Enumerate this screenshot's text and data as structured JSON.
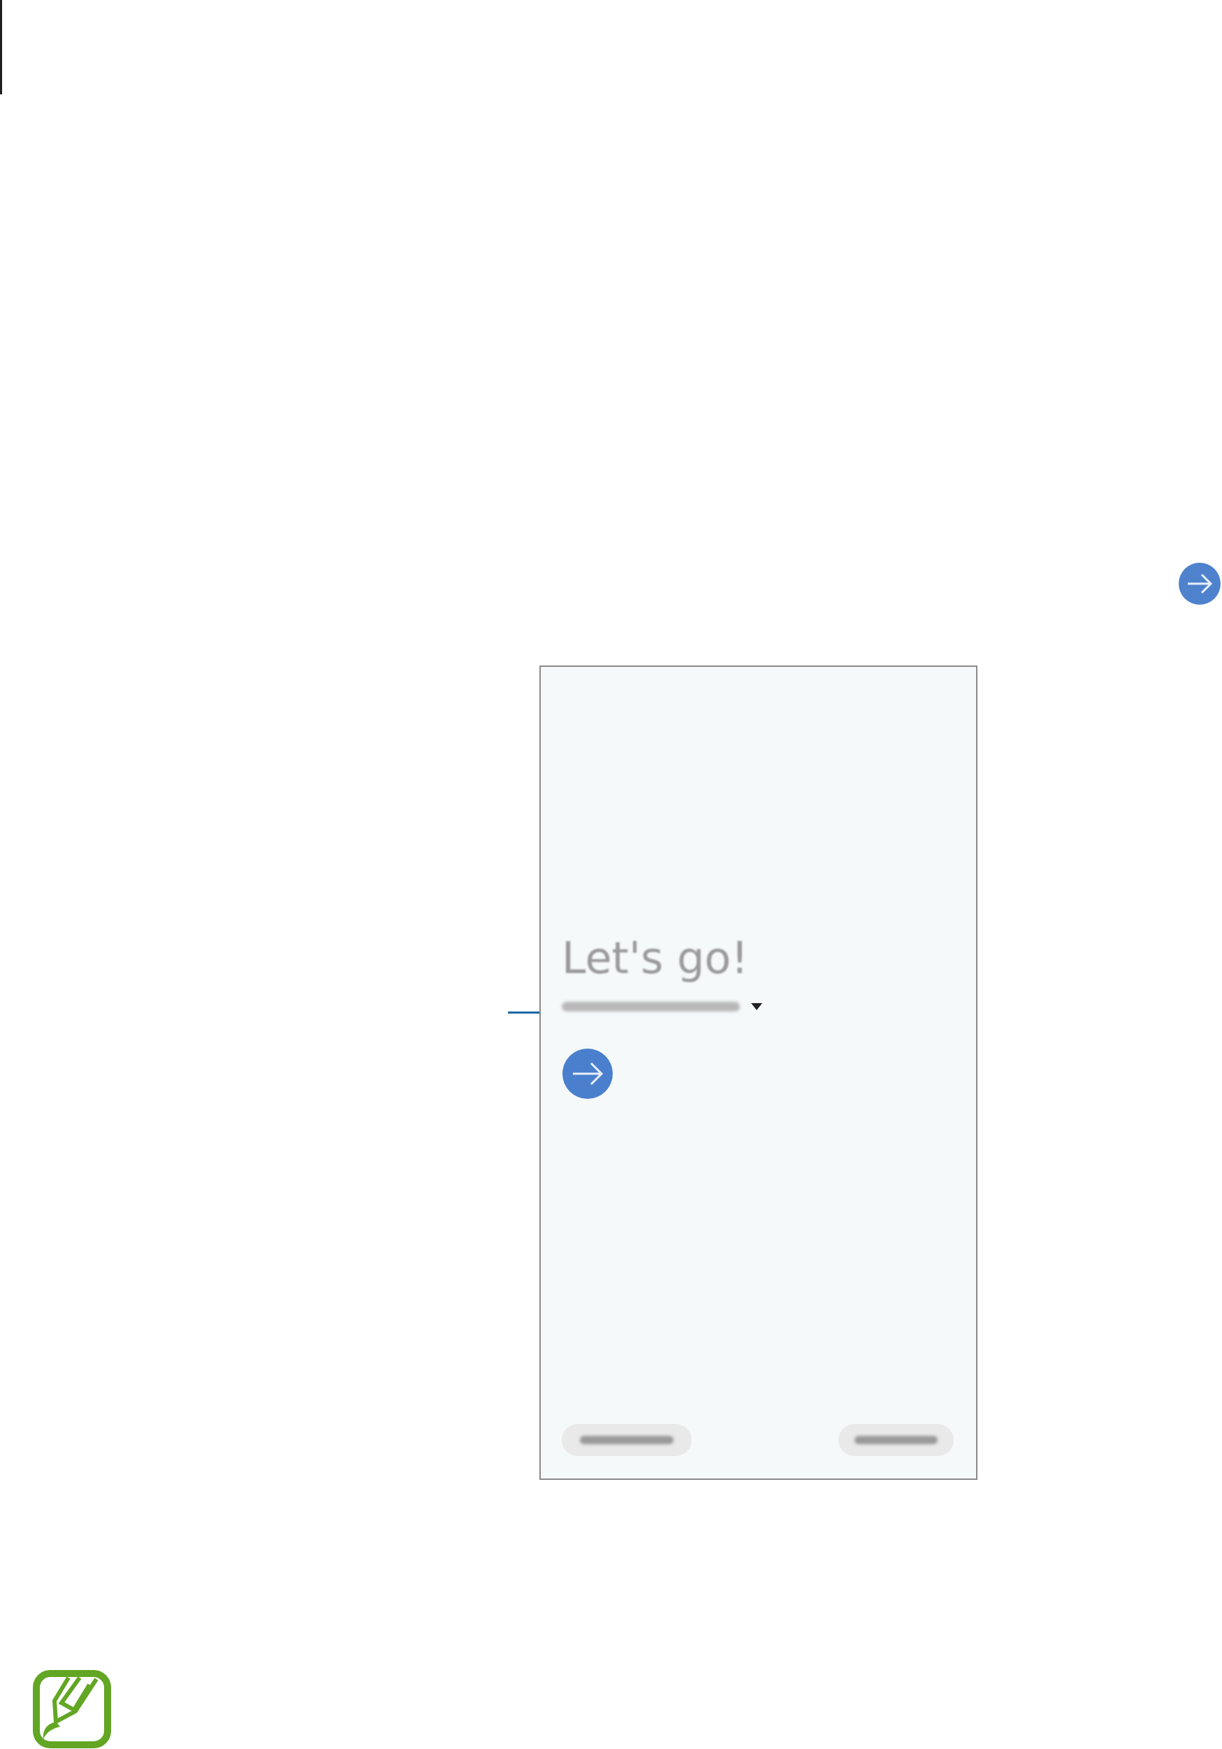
{
  "screen": {
    "title": "Let's go!"
  }
}
